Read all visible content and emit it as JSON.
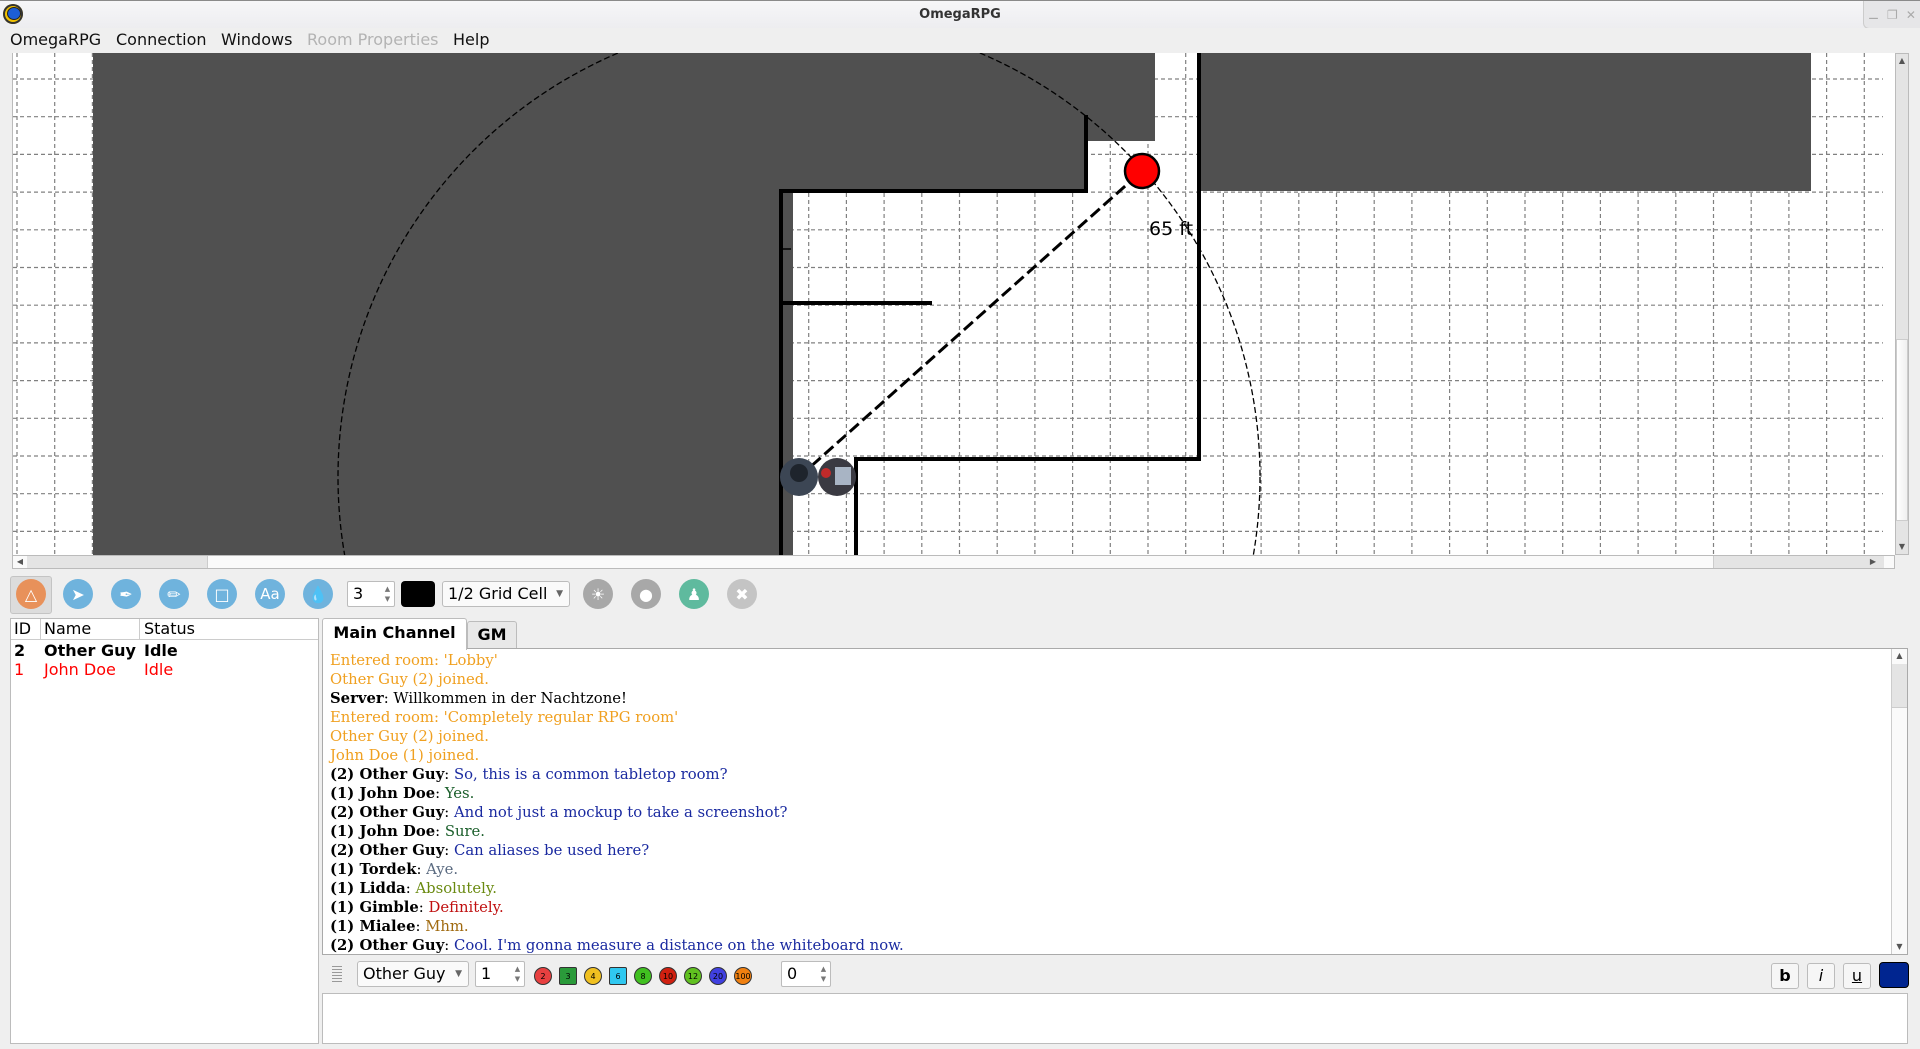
{
  "window": {
    "title": "OmegaRPG",
    "controls": [
      "minimize",
      "restore",
      "close"
    ]
  },
  "menu": [
    {
      "label": "OmegaRPG",
      "enabled": true
    },
    {
      "label": "Connection",
      "enabled": true
    },
    {
      "label": "Windows",
      "enabled": true
    },
    {
      "label": "Room Properties",
      "enabled": false
    },
    {
      "label": "Help",
      "enabled": true
    }
  ],
  "whiteboard": {
    "measure_label": "65 ft",
    "colors": {
      "wall": "#000000",
      "fog": "#505050",
      "grid": "#808080",
      "marker": "#ff0000"
    },
    "tokens": [
      "hooded-rogue-token",
      "robot-token"
    ]
  },
  "toolbar": {
    "tools": [
      {
        "name": "measure",
        "icon": "compass-icon",
        "color": "#e8915a",
        "active": true
      },
      {
        "name": "select",
        "icon": "pointer-icon",
        "color": "#6fb3dd"
      },
      {
        "name": "paint",
        "icon": "brush-icon",
        "color": "#6fb3dd"
      },
      {
        "name": "pencil",
        "icon": "pencil-icon",
        "color": "#6fb3dd"
      },
      {
        "name": "rectangle",
        "icon": "rectangle-icon",
        "color": "#6fb3dd"
      },
      {
        "name": "text",
        "icon": "text-icon",
        "label": "Aa",
        "color": "#6fb3dd"
      },
      {
        "name": "fill",
        "icon": "drop-icon",
        "color": "#6fb3dd"
      }
    ],
    "line_width": "3",
    "color": "#000000",
    "snap": "1/2 Grid Cell",
    "extra_tools": [
      {
        "name": "light-on",
        "icon": "lightbulb-on-icon",
        "color": "#a8a8a8"
      },
      {
        "name": "light-off",
        "icon": "lightbulb-off-icon",
        "color": "#a8a8a8"
      },
      {
        "name": "tokens",
        "icon": "pawn-icon",
        "color": "#5fba9e"
      },
      {
        "name": "settings",
        "icon": "tools-icon",
        "color": "#c4c4c4"
      }
    ]
  },
  "users": {
    "columns": [
      "ID",
      "Name",
      "Status"
    ],
    "rows": [
      {
        "id": "2",
        "name": "Other Guy",
        "status": "Idle",
        "color": "#000000",
        "bold": true
      },
      {
        "id": "1",
        "name": "John Doe",
        "status": "Idle",
        "color": "#ff0000",
        "bold": false
      }
    ]
  },
  "chat": {
    "tabs": [
      {
        "label": "Main Channel",
        "active": true
      },
      {
        "label": "GM",
        "active": false
      }
    ],
    "messages": [
      {
        "sender": "",
        "text": "Entered room: 'Lobby'",
        "color": "#f0a020"
      },
      {
        "sender": "",
        "text": "Other Guy (2) joined.",
        "color": "#f0a020"
      },
      {
        "sender": "Server",
        "text": "Willkommen in der Nachtzone!",
        "color": "#000000"
      },
      {
        "sender": "",
        "text": "Entered room: 'Completely regular RPG room'",
        "color": "#f0a020"
      },
      {
        "sender": "",
        "text": "Other Guy (2) joined.",
        "color": "#f0a020"
      },
      {
        "sender": "",
        "text": "John Doe (1) joined.",
        "color": "#f0a020"
      },
      {
        "sender": "(2) Other Guy",
        "text": "So, this is a common tabletop room?",
        "color": "#1a2aa0"
      },
      {
        "sender": "(1) John Doe",
        "text": "Yes.",
        "color": "#1a5e2a"
      },
      {
        "sender": "(2) Other Guy",
        "text": "And not just a mockup to take a screenshot?",
        "color": "#1a2aa0"
      },
      {
        "sender": "(1) John Doe",
        "text": "Sure.",
        "color": "#1a5e2a"
      },
      {
        "sender": "(2) Other Guy",
        "text": "Can aliases be used here?",
        "color": "#1a2aa0"
      },
      {
        "sender": "(1) Tordek",
        "text": "Aye.",
        "color": "#5a6a80"
      },
      {
        "sender": "(1) Lidda",
        "text": "Absolutely.",
        "color": "#6a8a10"
      },
      {
        "sender": "(1) Gimble",
        "text": "Definitely.",
        "color": "#c01010"
      },
      {
        "sender": "(1) Mialee",
        "text": "Mhm.",
        "color": "#a06a10"
      },
      {
        "sender": "(2) Other Guy",
        "text": "Cool. I'm gonna measure a distance on the whiteboard now.",
        "color": "#1a2aa0"
      }
    ],
    "alias_select": "Other Guy",
    "dice_count": "1",
    "dice": [
      {
        "label": "2",
        "name": "d2-icon",
        "color": "#e84040"
      },
      {
        "label": "3",
        "name": "d3-icon",
        "color": "#2a9a3a"
      },
      {
        "label": "4",
        "name": "d4-icon",
        "color": "#f0c020"
      },
      {
        "label": "6",
        "name": "d6-icon",
        "color": "#30c8f0"
      },
      {
        "label": "8",
        "name": "d8-icon",
        "color": "#40c020"
      },
      {
        "label": "10",
        "name": "d10-icon",
        "color": "#d02010"
      },
      {
        "label": "12",
        "name": "d12-icon",
        "color": "#60c020"
      },
      {
        "label": "20",
        "name": "d20-icon",
        "color": "#4040e0"
      },
      {
        "label": "100",
        "name": "d100-icon",
        "color": "#f08010"
      }
    ],
    "modifier": "0",
    "format": {
      "bold": "b",
      "italic": "i",
      "underline": "u",
      "text_color": "#002590"
    },
    "input_value": ""
  }
}
